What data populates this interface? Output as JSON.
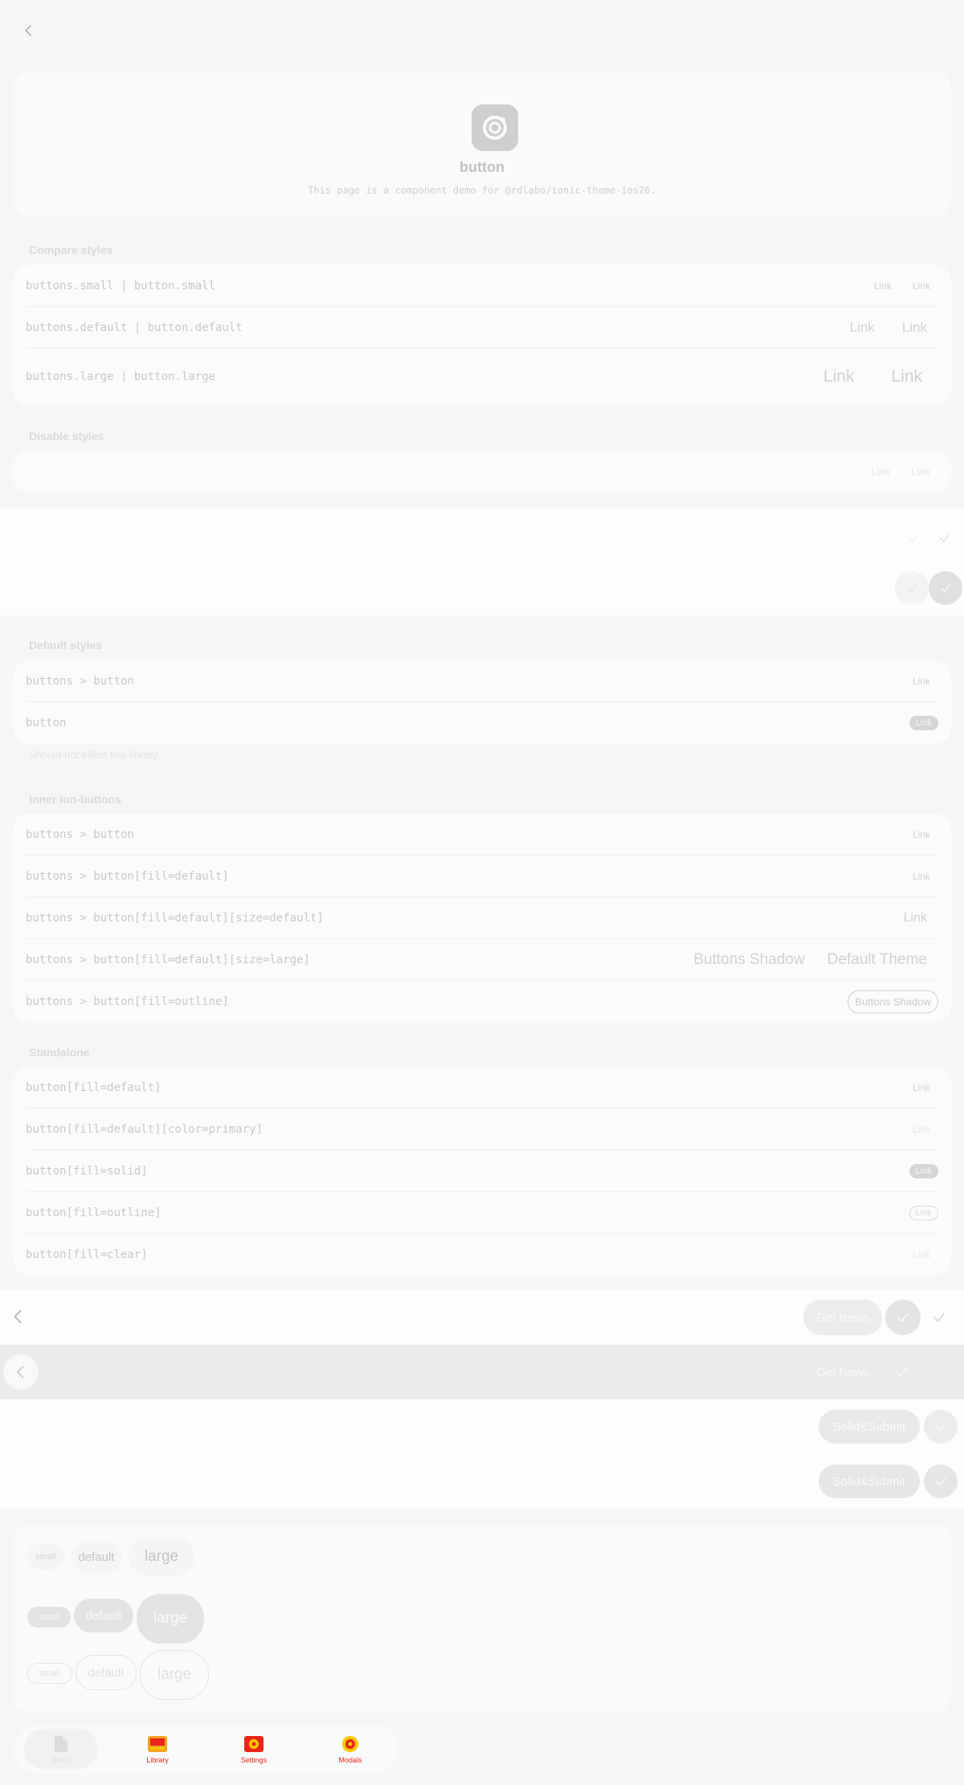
{
  "hero": {
    "title": "button",
    "description": "This page is a component demo for @rdlabo/ionic-theme-ios26."
  },
  "compare": {
    "title": "Compare styles",
    "rows": [
      {
        "label": "buttons.small | button.small",
        "a": "Link",
        "b": "Link"
      },
      {
        "label": "buttons.default | button.default",
        "a": "Link",
        "b": "Link"
      },
      {
        "label": "buttons.large | button.large",
        "a": "Link",
        "b": "Link"
      }
    ]
  },
  "disable": {
    "title": "Disable styles",
    "a": "Link",
    "b": "Link"
  },
  "default_styles": {
    "title": "Default styles",
    "rows": [
      {
        "label": "buttons > button",
        "value": "Link"
      },
      {
        "label": "button",
        "value": "Link"
      }
    ],
    "note": "Should not effect this library."
  },
  "inner": {
    "title": "Inner ion-buttons",
    "rows": [
      {
        "label": "buttons > button",
        "value": "Link"
      },
      {
        "label": "buttons > button[fill=default]",
        "value": "Link"
      },
      {
        "label": "buttons > button[fill=default][size=default]",
        "value": "Link"
      },
      {
        "label": "buttons > button[fill=default][size=large]",
        "value": "Buttons Shadow",
        "value2": "Default Theme"
      },
      {
        "label": "buttons > button[fill=outline]",
        "value": "Buttons Shadow"
      }
    ]
  },
  "standalone": {
    "title": "Standalone",
    "rows": [
      {
        "label": "button[fill=default]",
        "value": "Link"
      },
      {
        "label": "button[fill=default][color=primary]",
        "value": "Link"
      },
      {
        "label": "button[fill=solid]",
        "value": "Link"
      },
      {
        "label": "button[fill=outline]",
        "value": "Link"
      },
      {
        "label": "button[fill=clear]",
        "value": "Link"
      }
    ]
  },
  "toolbars": {
    "get_news": "Get News",
    "get_news_2": "Get News",
    "solid_submit": "Solid&Submit",
    "solid_submit_2": "Solid&Submit"
  },
  "sizes": {
    "clear": [
      "small",
      "default",
      "large"
    ],
    "solid": [
      "small",
      "default",
      "large"
    ],
    "outline": [
      "small",
      "default",
      "large"
    ]
  },
  "tabs": [
    {
      "label": "Basic",
      "icon": "document-icon"
    },
    {
      "label": "Library",
      "icon": "library-icon"
    },
    {
      "label": "Settings",
      "icon": "settings-icon"
    },
    {
      "label": "Modals",
      "icon": "modals-icon"
    }
  ],
  "colors": {
    "accent": "#e8261a",
    "accent_yellow": "#f5c800"
  }
}
